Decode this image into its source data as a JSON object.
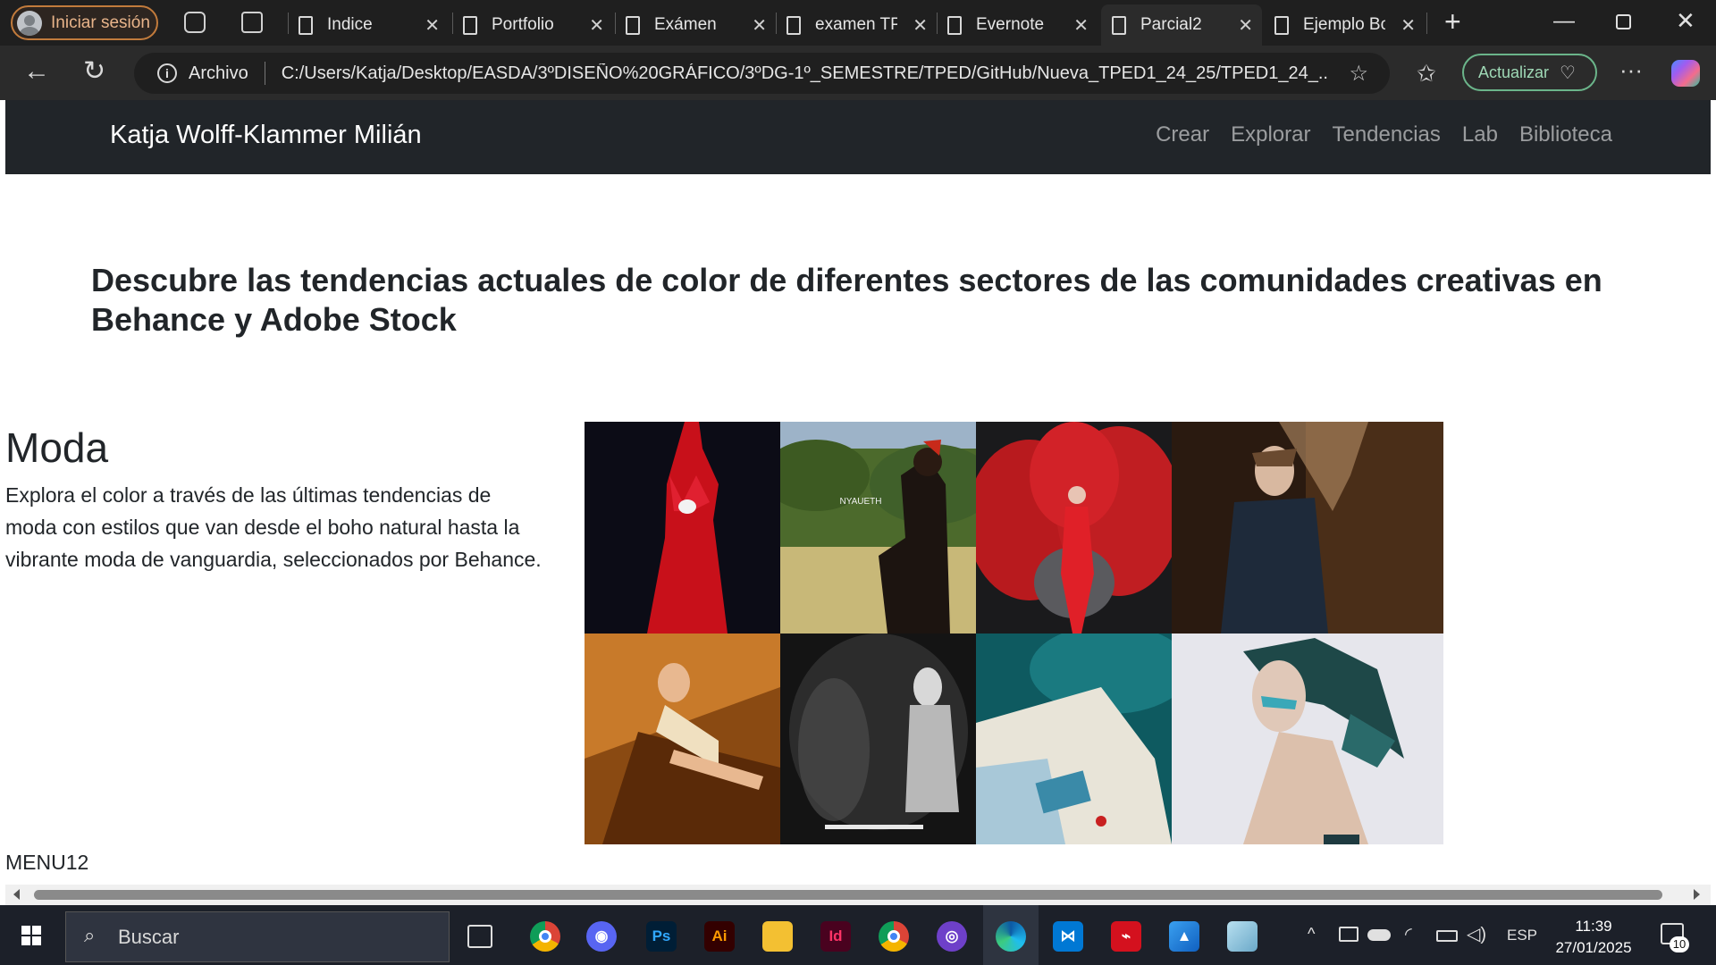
{
  "browser": {
    "signin_label": "Iniciar sesión",
    "tabs": [
      {
        "label": "Indice"
      },
      {
        "label": "Portfolio"
      },
      {
        "label": "Exámen"
      },
      {
        "label": "examen TP"
      },
      {
        "label": "Evernote"
      },
      {
        "label": "Parcial2",
        "active": true
      },
      {
        "label": "Ejemplo Bo"
      }
    ],
    "address": {
      "info_label": "Archivo",
      "url": "C:/Users/Katja/Desktop/EASDA/3ºDISEÑO%20GRÁFICO/3ºDG-1º_SEMESTRE/TPED/GitHub/Nueva_TPED1_24_25/TPED1_24_..."
    },
    "update_label": "Actualizar"
  },
  "site": {
    "brand": "Katja Wolff-Klammer Milián",
    "nav": [
      "Crear",
      "Explorar",
      "Tendencias",
      "Lab",
      "Biblioteca"
    ],
    "hero": "Descubre las tendencias actuales de color de diferentes sectores de las comunidades creativas en Behance y Adobe Stock",
    "section": {
      "title": "Moda",
      "text": "Explora el color a través de las últimas tendencias de moda con estilos que van desde el boho natural hasta la vibrante moda de vanguardia, seleccionados por Behance.",
      "tile_text": "NYAUETH"
    },
    "menu_label": "MENU12"
  },
  "taskbar": {
    "search_placeholder": "Buscar",
    "lang": "ESP",
    "time": "11:39",
    "date": "27/01/2025",
    "notifications": "10"
  },
  "colors": {
    "accent_update": "#6bb58a",
    "signin_border": "#c27b3c",
    "site_nav_bg": "#212529"
  }
}
